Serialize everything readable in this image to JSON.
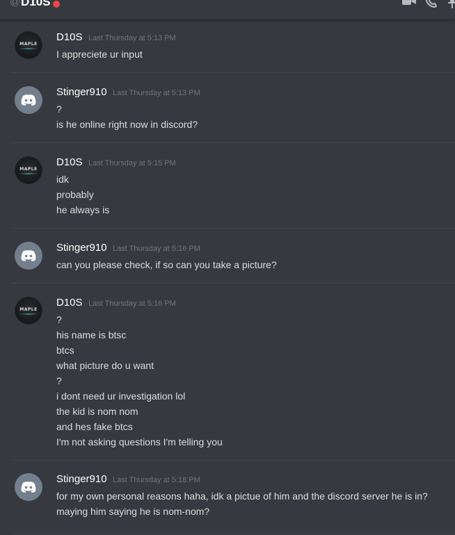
{
  "header": {
    "at_symbol": "@",
    "channel_name": "D10S",
    "status_color": "#f04747",
    "icons": [
      "video-call-icon",
      "voice-call-icon",
      "pin-icon"
    ]
  },
  "messages": [
    {
      "author": "D10S",
      "avatar": "maple-avatar",
      "avatar_text": "MAPLE",
      "timestamp": "Last Thursday at 5:13 PM",
      "lines": [
        "I appreciete ur input"
      ]
    },
    {
      "author": "Stinger910",
      "avatar": "discord-default-avatar",
      "timestamp": "Last Thursday at 5:13 PM",
      "lines": [
        "?",
        "is he online right now in discord?"
      ]
    },
    {
      "author": "D10S",
      "avatar": "maple-avatar",
      "avatar_text": "MAPLE",
      "timestamp": "Last Thursday at 5:15 PM",
      "lines": [
        "idk",
        "probably",
        "he always is"
      ]
    },
    {
      "author": "Stinger910",
      "avatar": "discord-default-avatar",
      "timestamp": "Last Thursday at 5:16 PM",
      "lines": [
        "can you please check, if so can you take a picture?"
      ]
    },
    {
      "author": "D10S",
      "avatar": "maple-avatar",
      "avatar_text": "MAPLE",
      "timestamp": "Last Thursday at 5:16 PM",
      "lines": [
        "?",
        "his name is btsc",
        "btcs",
        "what picture do u want",
        "?",
        "i dont need ur investigation lol",
        "the kid is nom nom",
        "and hes fake btcs",
        "I'm not asking questions I'm telling you"
      ]
    },
    {
      "author": "Stinger910",
      "avatar": "discord-default-avatar",
      "timestamp": "Last Thursday at 5:18 PM",
      "lines": [
        "for my own personal reasons haha, idk a pictue of him and the discord server he is in?",
        "maying him saying he is nom-nom?"
      ]
    }
  ]
}
